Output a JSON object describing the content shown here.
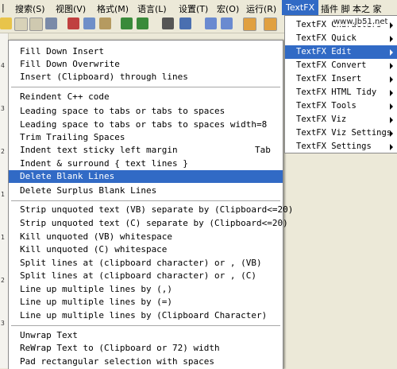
{
  "menubar": {
    "items": [
      "搜索(S)",
      "视图(V)",
      "格式(M)",
      "语言(L)",
      "设置(T)",
      "宏(O)",
      "运行(R)"
    ],
    "active": "TextFX",
    "trailing": "插件 脚 本之 家"
  },
  "watermark": "www.Jb51.net",
  "edit_menu": {
    "items": [
      "Fill Down Insert",
      "Fill Down Overwrite",
      "Insert (Clipboard) through lines",
      "Reindent C++ code",
      "Leading space to tabs or tabs to spaces",
      "Leading space to tabs or tabs to spaces width=8",
      "Trim Trailing Spaces",
      "Indent text sticky left margin",
      "Indent & surround { text lines }",
      "Delete Blank Lines",
      "Delete Surplus Blank Lines",
      "Strip unquoted text (VB) separate by (Clipboard<=20)",
      "Strip unquoted text (C) separate by (Clipboard<=20)",
      "Kill unquoted (VB) whitespace",
      "Kill unquoted (C) whitespace",
      "Split lines at (clipboard character) or , (VB)",
      "Split lines at (clipboard character) or , (C)",
      "Line up multiple lines by (,)",
      "Line up multiple lines by (=)",
      "Line up multiple lines by (Clipboard Character)",
      "Unwrap Text",
      "ReWrap Text to (Clipboard or 72) width",
      "Pad rectangular selection with spaces"
    ],
    "shortcut_tab": "Tab",
    "highlighted": "Delete Blank Lines"
  },
  "textfx_menu": {
    "items": [
      "TextFX Characters",
      "TextFX Quick",
      "TextFX Edit",
      "TextFX Convert",
      "TextFX Insert",
      "TextFX HTML Tidy",
      "TextFX Tools",
      "TextFX Viz",
      "TextFX Viz Settings",
      "TextFX Settings"
    ],
    "highlighted": "TextFX Edit"
  },
  "colors": {
    "highlight": "#316ac5",
    "menubar": "#ece9d8"
  }
}
